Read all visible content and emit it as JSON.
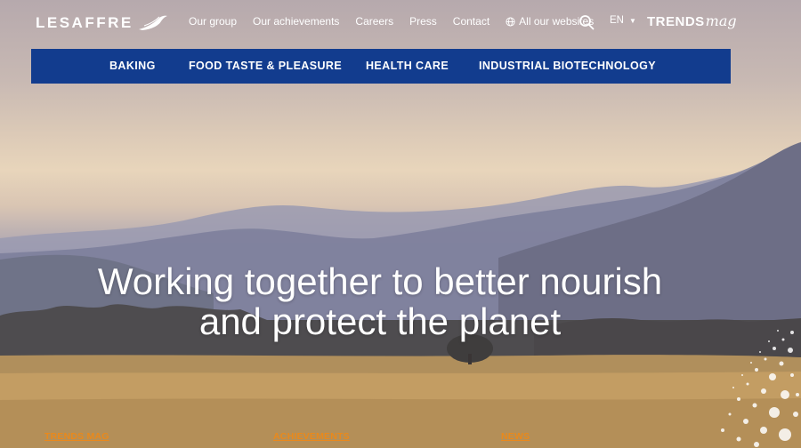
{
  "brand": {
    "logo_text": "LESAFFRE",
    "logo_icon": "bird-icon"
  },
  "top_links": [
    {
      "label": "Our group"
    },
    {
      "label": "Our achievements"
    },
    {
      "label": "Careers"
    },
    {
      "label": "Press"
    },
    {
      "label": "Contact"
    },
    {
      "label": "All our websites",
      "icon": "globe-icon"
    }
  ],
  "search": {
    "icon": "search-icon"
  },
  "language": {
    "label": "EN",
    "icon": "caret-down-icon"
  },
  "trends_mag": {
    "part1": "TRENDS",
    "part2": "mag"
  },
  "main_nav": [
    {
      "label": "BAKING"
    },
    {
      "label": "FOOD TASTE & PLEASURE"
    },
    {
      "label": "HEALTH CARE"
    },
    {
      "label": "INDUSTRIAL BIOTECHNOLOGY"
    }
  ],
  "hero": {
    "line1": "Working together to better nourish",
    "line2": "and protect the planet"
  },
  "teasers": [
    {
      "label": "TRENDS MAG"
    },
    {
      "label": "ACHIEVEMENTS"
    },
    {
      "label": "NEWS"
    }
  ],
  "colors": {
    "nav_bg": "#123c8e",
    "teaser_accent": "#e9891c"
  }
}
